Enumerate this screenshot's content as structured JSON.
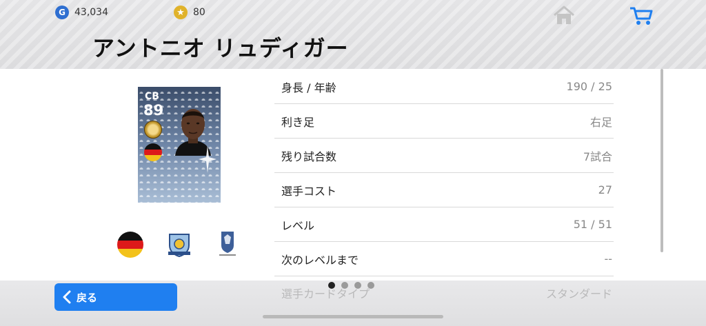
{
  "header": {
    "gp_amount": "43,034",
    "coin_amount": "80",
    "player_name": "アントニオ リュディガー"
  },
  "card": {
    "position": "CB",
    "rating": "89"
  },
  "stats": [
    {
      "label": "身長 / 年齢",
      "value": "190 / 25"
    },
    {
      "label": "利き足",
      "value": "右足"
    },
    {
      "label": "残り試合数",
      "value": "7試合"
    },
    {
      "label": "選手コスト",
      "value": "27"
    },
    {
      "label": "レベル",
      "value": "51 / 51"
    },
    {
      "label": "次のレベルまで",
      "value": "--"
    },
    {
      "label": "選手カードタイプ",
      "value": "スタンダード"
    }
  ],
  "footer": {
    "back_label": "戻る"
  },
  "colors": {
    "accent": "#1f7ff0",
    "gp": "#2f6fd1",
    "coin": "#e0b22a"
  },
  "icons": [
    "gp-coin-icon",
    "star-coin-icon",
    "home-icon",
    "cart-icon",
    "chevron-left-icon"
  ]
}
